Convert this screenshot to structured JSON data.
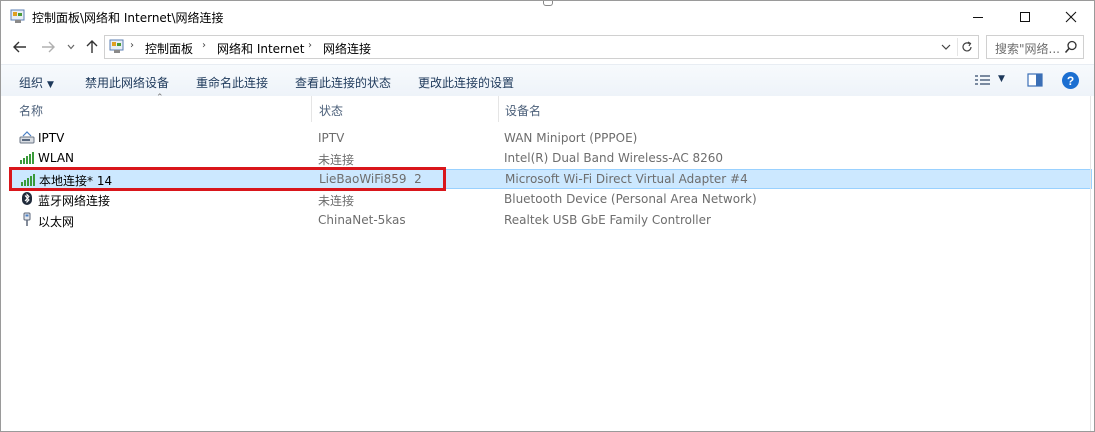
{
  "window": {
    "title": "控制面板\\网络和 Internet\\网络连接",
    "controls": {
      "minimize": "—",
      "maximize": "☐",
      "close": "✕"
    }
  },
  "address": {
    "segments": [
      "控制面板",
      "网络和 Internet",
      "网络连接"
    ],
    "separator": "›"
  },
  "search": {
    "placeholder": "搜索\"网络..."
  },
  "commands": {
    "organize": "组织",
    "disable": "禁用此网络设备",
    "rename": "重命名此连接",
    "view_status": "查看此连接的状态",
    "change_settings": "更改此连接的设置"
  },
  "columns": {
    "name": "名称",
    "status": "状态",
    "device": "设备名"
  },
  "connections": [
    {
      "name": "IPTV",
      "status": "IPTV",
      "device": "WAN Miniport (PPPOE)",
      "icon": "dialup-icon",
      "selected": false
    },
    {
      "name": "WLAN",
      "status": "未连接",
      "device": "Intel(R) Dual Band Wireless-AC 8260",
      "icon": "wifi-signal-icon",
      "selected": false
    },
    {
      "name": "本地连接* 14",
      "status": "LieBaoWiFi859  2",
      "device": "Microsoft Wi-Fi Direct Virtual Adapter #4",
      "icon": "wifi-signal-icon",
      "selected": true
    },
    {
      "name": "蓝牙网络连接",
      "status": "未连接",
      "device": "Bluetooth Device (Personal Area Network)",
      "icon": "bluetooth-icon",
      "selected": false
    },
    {
      "name": "以太网",
      "status": "ChinaNet-5kas",
      "device": "Realtek USB GbE Family Controller",
      "icon": "ethernet-icon",
      "selected": false
    }
  ],
  "colors": {
    "selection": "#cce8ff",
    "highlight_box": "#d9161b",
    "accent": "#1c6fd1"
  }
}
